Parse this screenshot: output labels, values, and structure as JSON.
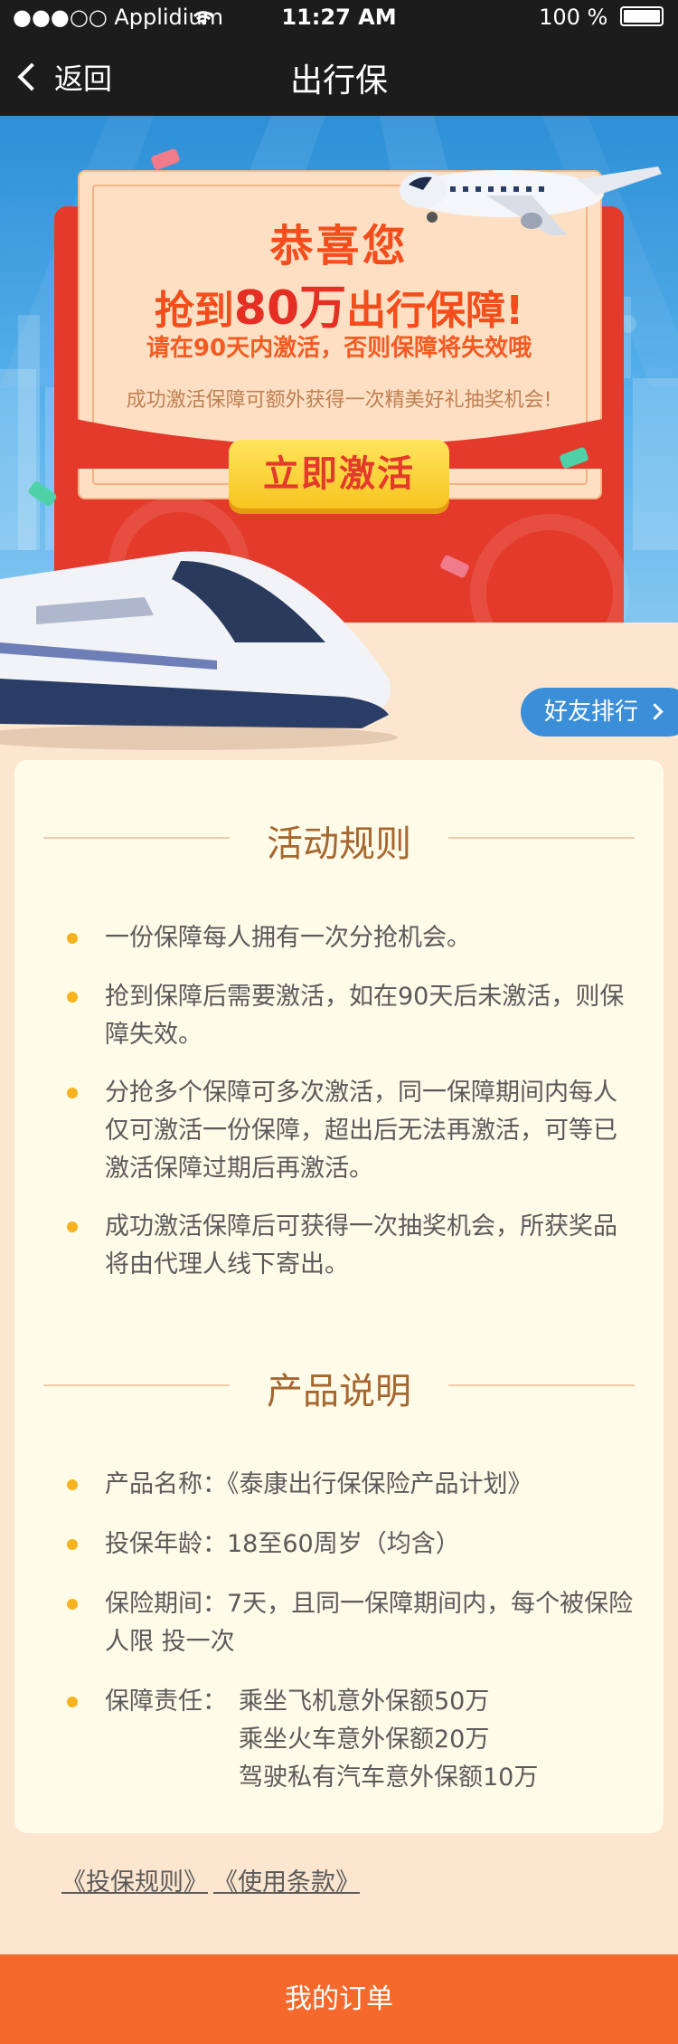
{
  "status_bar": {
    "carrier": "●●●○○ Applidium",
    "time": "11:27 AM",
    "battery_percent": "100 %",
    "icons": [
      "wifi-icon",
      "battery-icon"
    ]
  },
  "nav": {
    "back_label": "返回",
    "title": "出行保"
  },
  "hero": {
    "congrats": "恭喜您",
    "headline_prefix": "抢到",
    "headline_amount": "80万",
    "headline_suffix": "出行保障!",
    "deadline": "请在90天内激活，否则保障将失效哦",
    "bonus": "成功激活保障可额外获得一次精美好礼抽奖机会!",
    "activate_label": "立即激活"
  },
  "ranking_label": "好友排行",
  "rules": {
    "title": "活动规则",
    "items": [
      "一份保障每人拥有一次分抢机会。",
      "抢到保障后需要激活，如在90天后未激活，则保障失效。",
      "分抢多个保障可多次激活，同一保障期间内每人仅可激活一份保障，超出后无法再激活，可等已激活保障过期后再激活。",
      "成功激活保障后可获得一次抽奖机会，所获奖品将由代理人线下寄出。"
    ]
  },
  "product": {
    "title": "产品说明",
    "name_label": "产品名称：",
    "name_value": "《泰康出行保保险产品计划》",
    "age_label": "投保年龄：",
    "age_value": "18至60周岁（均含）",
    "period_label": "保险期间：",
    "period_value": "7天，且同一保障期间内，每个被保险人限 投一次",
    "coverage_label": "保障责任：",
    "coverage_lines": [
      "乘坐飞机意外保额50万",
      "乘坐火车意外保额20万",
      "驾驶私有汽车意外保额10万"
    ]
  },
  "links": {
    "rules_link": "《投保规则》",
    "terms_link": "《使用条款》"
  },
  "bottom_bar": {
    "my_orders": "我的订单"
  },
  "colors": {
    "accent_orange": "#f6692d",
    "envelope_red": "#e43a2b",
    "button_yellow": "#f7c521",
    "title_brown": "#a6672e",
    "bullet_yellow": "#f5b31f",
    "pill_blue": "#3b8fd8"
  }
}
